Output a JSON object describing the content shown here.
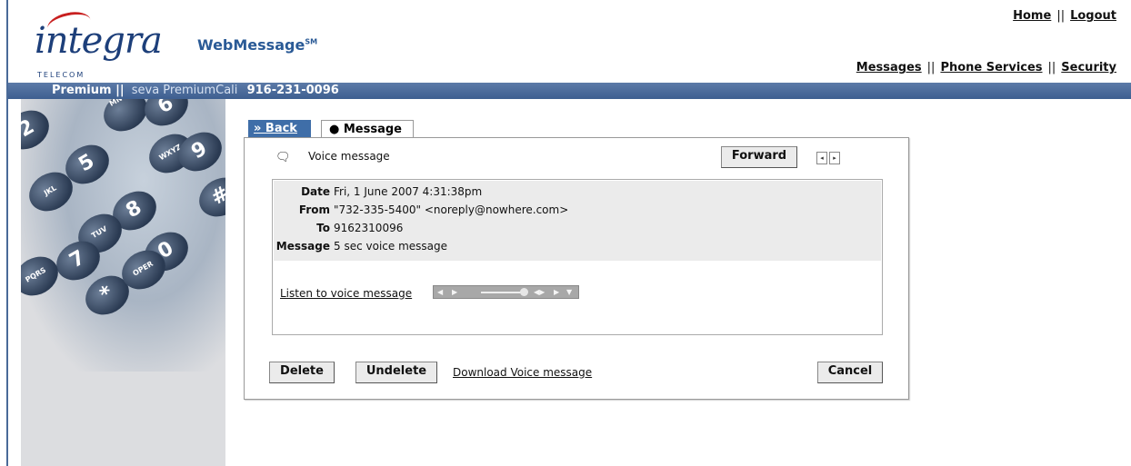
{
  "brand": {
    "logo_text": "integra",
    "logo_sub": "TELECOM",
    "app_title": "WebMessage",
    "app_title_mark": "SM"
  },
  "top_links": {
    "home": "Home",
    "logout": "Logout",
    "separator": "||"
  },
  "nav_links": {
    "messages": "Messages",
    "phone_services": "Phone Services",
    "security": "Security",
    "separator": "||"
  },
  "user_bar": {
    "plan": "Premium ||",
    "user": "seva PremiumCali",
    "phone": "916-231-0096"
  },
  "keypad": {
    "keys": [
      "2",
      "MNO",
      "6",
      "5",
      "WXYZ",
      "9",
      "JKL",
      "8",
      "TUV",
      "0",
      "#",
      "7",
      "PQRS",
      "*",
      "OPER"
    ]
  },
  "tabs": {
    "back": "» Back",
    "message": "● Message"
  },
  "message": {
    "type_label": "Voice message",
    "forward_label": "Forward",
    "prev_arrow": "◂",
    "next_arrow": "▸",
    "fields": [
      {
        "label": "Date",
        "value": "Fri, 1 June 2007 4:31:38pm"
      },
      {
        "label": "From",
        "value": "\"732-335-5400\" <noreply@nowhere.com>"
      },
      {
        "label": "To",
        "value": "9162310096"
      },
      {
        "label": "Message",
        "value": "5 sec voice message"
      }
    ],
    "listen_label": "Listen to voice message",
    "player_controls": [
      "◀",
      "▶",
      "◀▶",
      "▶",
      "▼"
    ]
  },
  "actions": {
    "delete": "Delete",
    "undelete": "Undelete",
    "download": "Download Voice message",
    "cancel": "Cancel"
  },
  "colors": {
    "accent": "#3f6ea8",
    "bar": "#4d6e9e",
    "title": "#2a5a96",
    "logo_red": "#c82020"
  }
}
